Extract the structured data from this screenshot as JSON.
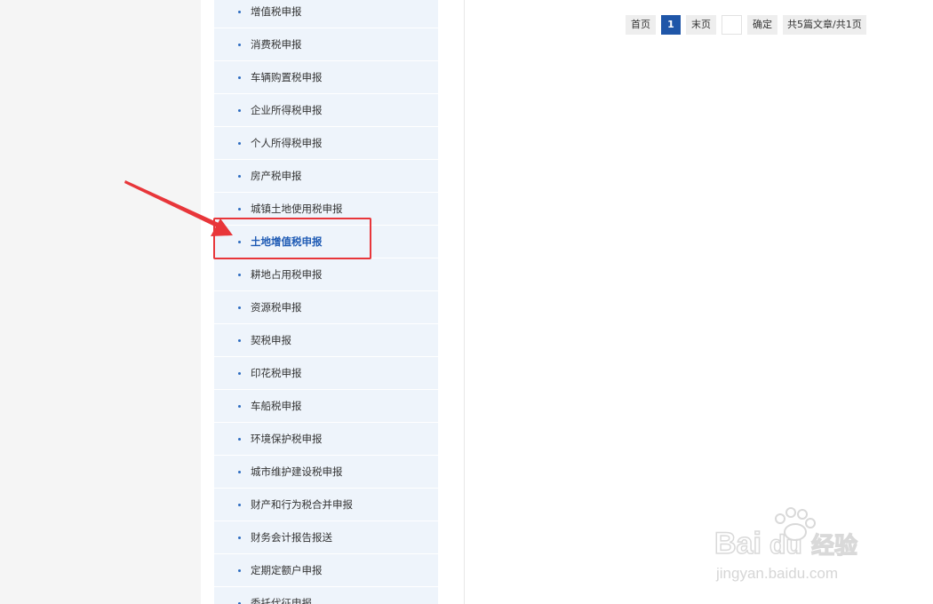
{
  "sidebar": {
    "items": [
      {
        "label": "增值税申报"
      },
      {
        "label": "消费税申报"
      },
      {
        "label": "车辆购置税申报"
      },
      {
        "label": "企业所得税申报"
      },
      {
        "label": "个人所得税申报"
      },
      {
        "label": "房产税申报"
      },
      {
        "label": "城镇土地使用税申报"
      },
      {
        "label": "土地增值税申报",
        "active": true
      },
      {
        "label": "耕地占用税申报"
      },
      {
        "label": "资源税申报"
      },
      {
        "label": "契税申报"
      },
      {
        "label": "印花税申报"
      },
      {
        "label": "车船税申报"
      },
      {
        "label": "环境保护税申报"
      },
      {
        "label": "城市维护建设税申报"
      },
      {
        "label": "财产和行为税合并申报"
      },
      {
        "label": "财务会计报告报送"
      },
      {
        "label": "定期定额户申报"
      },
      {
        "label": "委托代征申报"
      }
    ]
  },
  "pager": {
    "first_label": "首页",
    "current_page": "1",
    "last_label": "末页",
    "page_input_value": "",
    "confirm_label": "确定",
    "total_text": "共5篇文章/共1页"
  },
  "colors": {
    "accent": "#1f56a8",
    "annotation": "#e8363a",
    "sidebar_bg": "#eef4fb"
  },
  "watermark": {
    "brand": "Baidu经验",
    "url": "jingyan.baidu.com"
  }
}
